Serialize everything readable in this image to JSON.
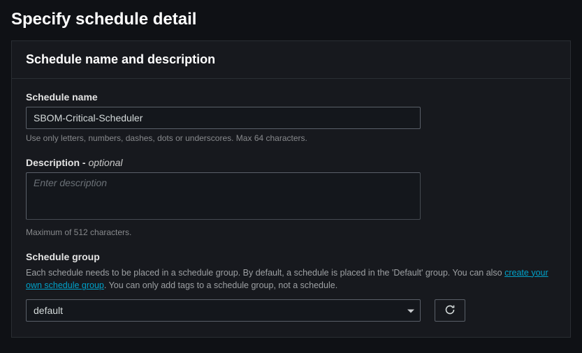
{
  "page": {
    "title": "Specify schedule detail"
  },
  "panel": {
    "title": "Schedule name and description"
  },
  "scheduleName": {
    "label": "Schedule name",
    "value": "SBOM-Critical-Scheduler",
    "help": "Use only letters, numbers, dashes, dots or underscores. Max 64 characters."
  },
  "description": {
    "labelMain": "Description - ",
    "labelOptional": "optional",
    "placeholder": "Enter description",
    "value": "",
    "help": "Maximum of 512 characters."
  },
  "scheduleGroup": {
    "label": "Schedule group",
    "descPrefix": "Each schedule needs to be placed in a schedule group. By default, a schedule is placed in the 'Default' group. You can also ",
    "linkText": "create your own schedule group",
    "descSuffix": ". You can only add tags to a schedule group, not a schedule.",
    "selected": "default"
  }
}
